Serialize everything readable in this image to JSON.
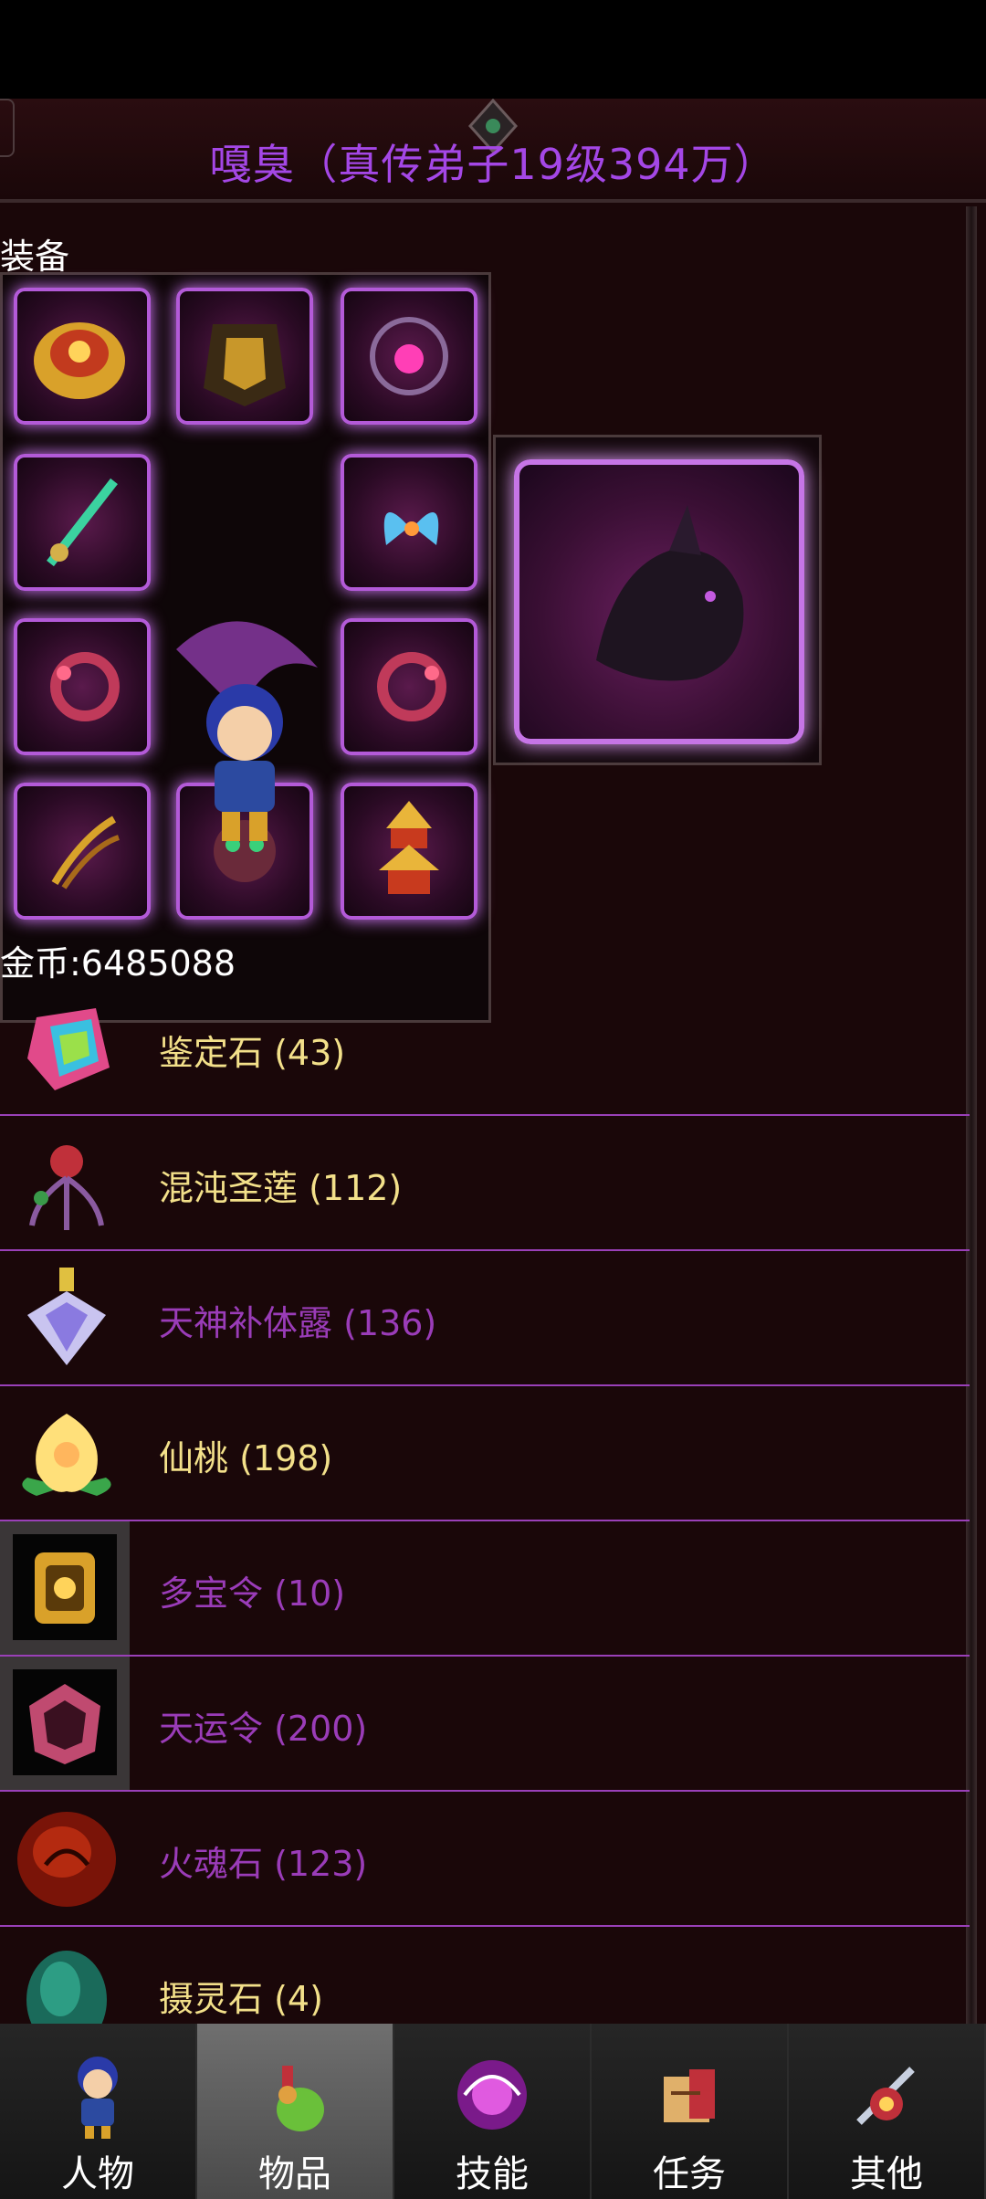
{
  "window": {
    "title": "嘎臭（真传弟子19级394万）",
    "section_label": "装备",
    "gold_text": "金币:6485088"
  },
  "items": [
    {
      "label": "鉴定石 (43)",
      "color": "#f3e08a",
      "icon": "rainbow-gem-icon"
    },
    {
      "label": "混沌圣莲 (112)",
      "color": "#f3e08a",
      "icon": "chaos-lotus-icon"
    },
    {
      "label": "天神补体露 (136)",
      "color": "#9a3cb8",
      "icon": "crystal-potion-icon"
    },
    {
      "label": "仙桃 (198)",
      "color": "#f3e08a",
      "icon": "peach-icon"
    },
    {
      "label": "多宝令 (10)",
      "color": "#9a3cb8",
      "icon": "treasure-token-icon"
    },
    {
      "label": "天运令 (200)",
      "color": "#9a3cb8",
      "icon": "fortune-token-icon"
    },
    {
      "label": "火魂石 (123)",
      "color": "#9a3cb8",
      "icon": "fire-soul-stone-icon"
    },
    {
      "label": "摄灵石 (4)",
      "color": "#f3e08a",
      "icon": "spirit-stone-icon"
    }
  ],
  "tabs": [
    {
      "label": "人物",
      "icon": "character-icon",
      "active": false
    },
    {
      "label": "物品",
      "icon": "potion-bag-icon",
      "active": true
    },
    {
      "label": "技能",
      "icon": "skill-orb-icon",
      "active": false
    },
    {
      "label": "任务",
      "icon": "quest-book-icon",
      "active": false
    },
    {
      "label": "其他",
      "icon": "other-sword-icon",
      "active": false
    }
  ],
  "colors": {
    "title": "#a447e6",
    "slot_glow": "#b35ad8",
    "row_divider": "#9a40b8",
    "window_bg": "#1a0709"
  }
}
